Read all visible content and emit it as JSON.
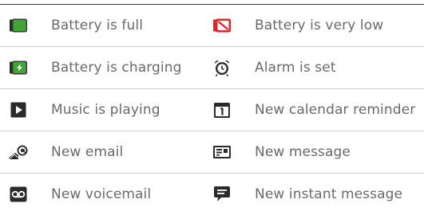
{
  "legend": {
    "rows": [
      {
        "left": {
          "icon": "battery-full-icon",
          "label": "Battery is full"
        },
        "right": {
          "icon": "battery-very-low-icon",
          "label": "Battery is very low"
        }
      },
      {
        "left": {
          "icon": "battery-charging-icon",
          "label": "Battery is charging"
        },
        "right": {
          "icon": "alarm-clock-icon",
          "label": "Alarm is set"
        }
      },
      {
        "left": {
          "icon": "music-play-icon",
          "label": "Music is playing"
        },
        "right": {
          "icon": "calendar-icon",
          "label": "New calendar reminder"
        }
      },
      {
        "left": {
          "icon": "email-icon",
          "label": "New email"
        },
        "right": {
          "icon": "message-icon",
          "label": "New message"
        }
      },
      {
        "left": {
          "icon": "voicemail-icon",
          "label": "New voicemail"
        },
        "right": {
          "icon": "instant-message-icon",
          "label": "New instant message"
        }
      }
    ]
  },
  "colors": {
    "battery_green": "#3fa535",
    "battery_red": "#e0262b",
    "icon_dark": "#2b2b2b",
    "text": "#6a6a6a"
  }
}
